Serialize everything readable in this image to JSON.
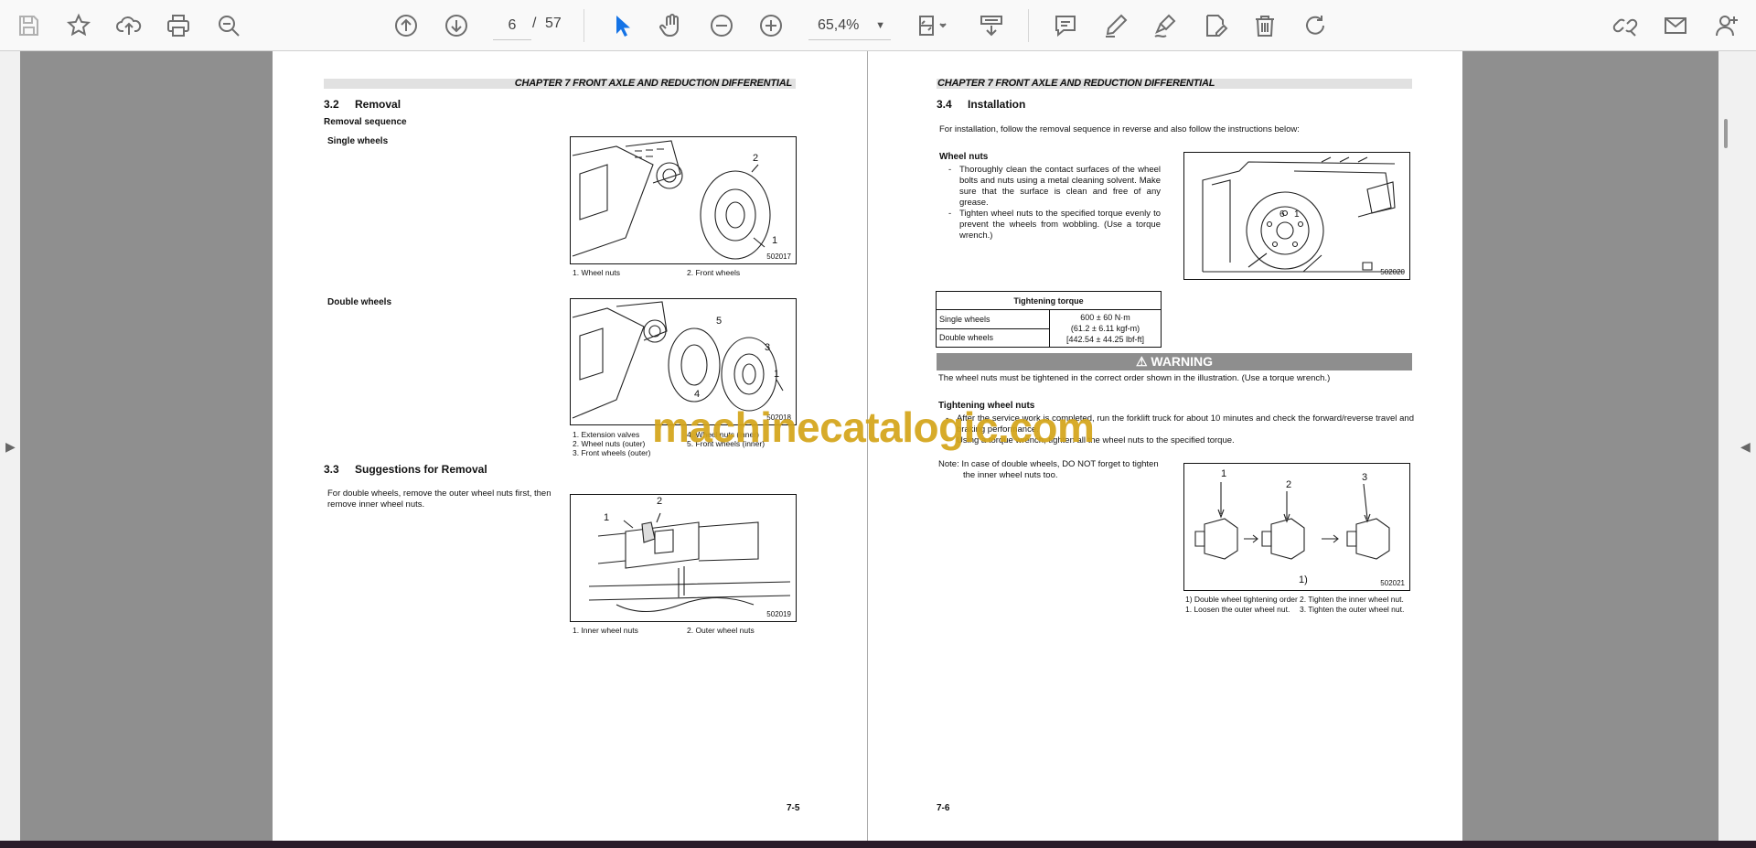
{
  "toolbar": {
    "page_current": "6",
    "page_separator": "/",
    "page_total": "57",
    "zoom": "65,4%",
    "accent_color": "#1473e6",
    "icons": [
      "save-icon",
      "bookmark-star-icon",
      "upload-cloud-icon",
      "print-icon",
      "zoom-search-icon",
      "page-up-icon",
      "page-down-icon",
      "zoom-out-icon",
      "zoom-in-icon",
      "select-cursor-icon",
      "hand-tool-icon",
      "fit-page-icon",
      "scroll-mode-icon",
      "comment-icon",
      "highlight-pen-icon",
      "sign-icon",
      "edit-doc-icon",
      "delete-icon",
      "redo-icon",
      "share-link-icon",
      "email-icon",
      "add-user-icon"
    ]
  },
  "watermark": "machinecatalogic.com",
  "page_left": {
    "chapter_header": "CHAPTER 7 FRONT AXLE AND REDUCTION DIFFERENTIAL",
    "sec_removal_num": "3.2",
    "sec_removal_title": "Removal",
    "removal_sequence": "Removal sequence",
    "single_wheels": "Single wheels",
    "fig1_code": "502017",
    "fig1_callout_1": "1",
    "fig1_callout_2": "2",
    "fig1_cap_1": "1.  Wheel nuts",
    "fig1_cap_2": "2.  Front wheels",
    "double_wheels": "Double wheels",
    "fig2_code": "502018",
    "fig2_callout_1": "1",
    "fig2_callout_3": "3",
    "fig2_callout_4": "4",
    "fig2_callout_5": "5",
    "fig2_cap_1": "1.  Extension valves",
    "fig2_cap_2": "2.  Wheel nuts (outer)",
    "fig2_cap_3": "3.  Front wheels (outer)",
    "fig2_cap_4": "4.  Wheel nuts (inner)",
    "fig2_cap_5": "5.  Front wheels (inner)",
    "sec_suggest_num": "3.3",
    "sec_suggest_title": "Suggestions for Removal",
    "suggest_text": "For double wheels, remove the outer wheel nuts first, then remove inner wheel nuts.",
    "fig3_code": "502019",
    "fig3_callout_1": "1",
    "fig3_callout_2": "2",
    "fig3_cap_1": "1.  Inner wheel nuts",
    "fig3_cap_2": "2.  Outer wheel nuts",
    "page_number": "7-5"
  },
  "page_right": {
    "chapter_header": "CHAPTER 7 FRONT AXLE AND REDUCTION DIFFERENTIAL",
    "sec_install_num": "3.4",
    "sec_install_title": "Installation",
    "install_intro": "For installation, follow the removal sequence in reverse and also follow the instructions below:",
    "wheel_nuts_heading": "Wheel nuts",
    "bullet_1": "Thoroughly clean the contact surfaces of the wheel bolts and nuts using a metal cleaning solvent. Make sure that the surface is clean and free of any grease.",
    "bullet_2": "Tighten wheel nuts to the specified torque evenly to prevent the wheels from wobbling. (Use a torque wrench.)",
    "fig4_code": "502020",
    "fig4_callout_6": "6",
    "fig4_callout_1": "1",
    "torque_table": {
      "header": "Tightening torque",
      "row1_label": "Single wheels",
      "row2_label": "Double wheels",
      "value_line1": "600 ± 60 N·m",
      "value_line2": "(61.2 ± 6.11 kgf-m)",
      "value_line3": "[442.54 ± 44.25 lbf-ft]"
    },
    "warning_title": "⚠ WARNING",
    "warning_text": "The wheel nuts must be tightened in the correct order shown in the illustration. (Use a torque wrench.)",
    "tightening_heading": "Tightening wheel nuts",
    "tightening_bullet_1": "After the service work is completed, run the forklift truck for about 10 minutes and check the forward/reverse travel and braking performance.",
    "tightening_bullet_2": "Using a torque wrench, tighten all the wheel nuts to the specified torque.",
    "note_text": "Note: In case of double wheels, DO NOT forget to tighten the inner wheel nuts too.",
    "fig5_code": "502021",
    "fig5_callout_1": "1",
    "fig5_callout_2": "2",
    "fig5_callout_3": "3",
    "fig5_sub": "1)",
    "fig5_cap_a": "1) Double wheel tightening order",
    "fig5_cap_b": "2. Tighten the inner wheel nut.",
    "fig5_cap_c": "1. Loosen the outer wheel nut.",
    "fig5_cap_d": "3. Tighten the outer wheel nut.",
    "page_number": "7-6"
  }
}
